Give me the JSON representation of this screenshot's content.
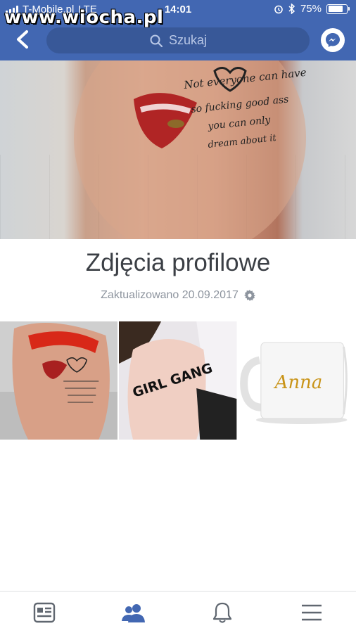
{
  "status_bar": {
    "carrier": "T-Mobile.pl",
    "network": "LTE",
    "time": "14:01",
    "battery": "75%"
  },
  "watermark": "www.wiocha.pl",
  "header": {
    "search_placeholder": "Szukaj",
    "color": "#4267b2"
  },
  "album": {
    "title": "Zdjęcia profilowe",
    "updated": "Zaktualizowano 20.09.2017"
  },
  "cover_text": [
    "Not everyone can have",
    "so fucking good ass",
    "you can only",
    "dream about it"
  ],
  "thumbnails": [
    {
      "name": "thumb-tattoo"
    },
    {
      "name": "thumb-girl-gang",
      "text": "GIRL GANG"
    },
    {
      "name": "thumb-mug",
      "text": "Anna"
    }
  ],
  "tabbar": {
    "items": [
      "news-feed-icon",
      "friends-icon",
      "notifications-icon",
      "menu-icon"
    ],
    "active": "friends-icon",
    "active_color": "#4267b2",
    "inactive_color": "#606770"
  }
}
